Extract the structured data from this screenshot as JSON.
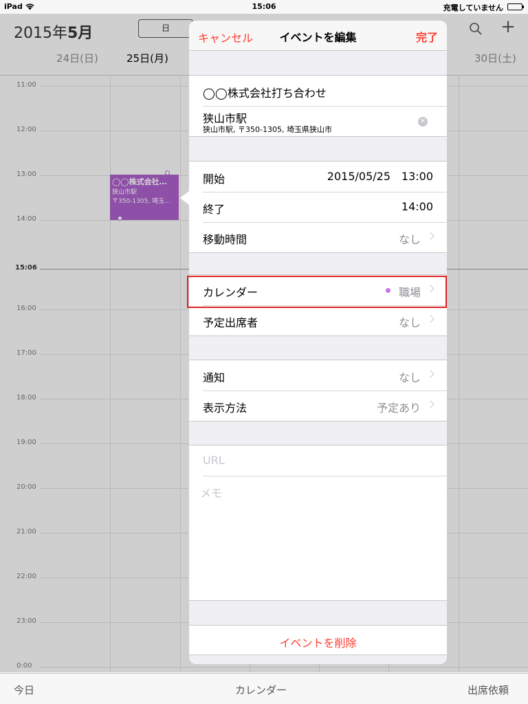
{
  "status": {
    "carrier": "iPad",
    "time": "15:06",
    "battery": "充電していません"
  },
  "header": {
    "month_year": "2015年",
    "month_num": "5月",
    "view_segment": "日",
    "days": [
      "24日(日)",
      "25日(月)",
      "30日(土)"
    ]
  },
  "grid": {
    "hours": [
      "11:00",
      "12:00",
      "13:00",
      "14:00",
      "16:00",
      "17:00",
      "18:00",
      "19:00",
      "20:00",
      "21:00",
      "22:00",
      "23:00",
      "0:00"
    ],
    "now": "15:06",
    "event": {
      "title": "◯◯株式会社…",
      "line2": "狭山市駅",
      "line3": "〒350-1305, 埼玉…",
      "color": "#a95fc7"
    }
  },
  "popover": {
    "cancel": "キャンセル",
    "title": "イベントを編集",
    "done": "完了",
    "event_title": "◯◯株式会社打ち合わせ",
    "location": "狭山市駅",
    "location_detail": "狭山市駅, 〒350-1305, 埼玉県狭山市",
    "start_label": "開始",
    "start_date": "2015/05/25",
    "start_time": "13:00",
    "end_label": "終了",
    "end_time": "14:00",
    "travel_label": "移動時間",
    "travel_value": "なし",
    "calendar_label": "カレンダー",
    "calendar_value": "職場",
    "calendar_color": "#cc73e1",
    "attendees_label": "予定出席者",
    "attendees_value": "なし",
    "alert_label": "通知",
    "alert_value": "なし",
    "show_as_label": "表示方法",
    "show_as_value": "予定あり",
    "url_placeholder": "URL",
    "notes_placeholder": "メモ",
    "delete": "イベントを削除"
  },
  "toolbar": {
    "today": "今日",
    "calendars": "カレンダー",
    "inbox": "出席依頼"
  }
}
